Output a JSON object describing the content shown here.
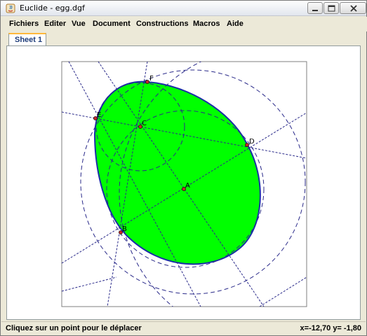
{
  "window": {
    "title": "Euclide - egg.dgf"
  },
  "menu": {
    "items": [
      "Fichiers",
      "Editer",
      "Vue",
      "Document",
      "Constructions",
      "Macros",
      "Aide"
    ]
  },
  "tabs": [
    "Sheet 1"
  ],
  "drawing": {
    "points": [
      {
        "label": "F"
      },
      {
        "label": "E"
      },
      {
        "label": "C"
      },
      {
        "label": "D"
      },
      {
        "label": "A"
      },
      {
        "label": "B"
      }
    ],
    "colors": {
      "egg_fill": "#00ff00",
      "egg_stroke": "#1a2ea8",
      "construction_stroke": "#2a2a8a",
      "point_fill": "#c0282c"
    }
  },
  "status": {
    "message": "Cliquez sur un point pour le déplacer",
    "coords": "x=-12,70 y= -1,80"
  }
}
